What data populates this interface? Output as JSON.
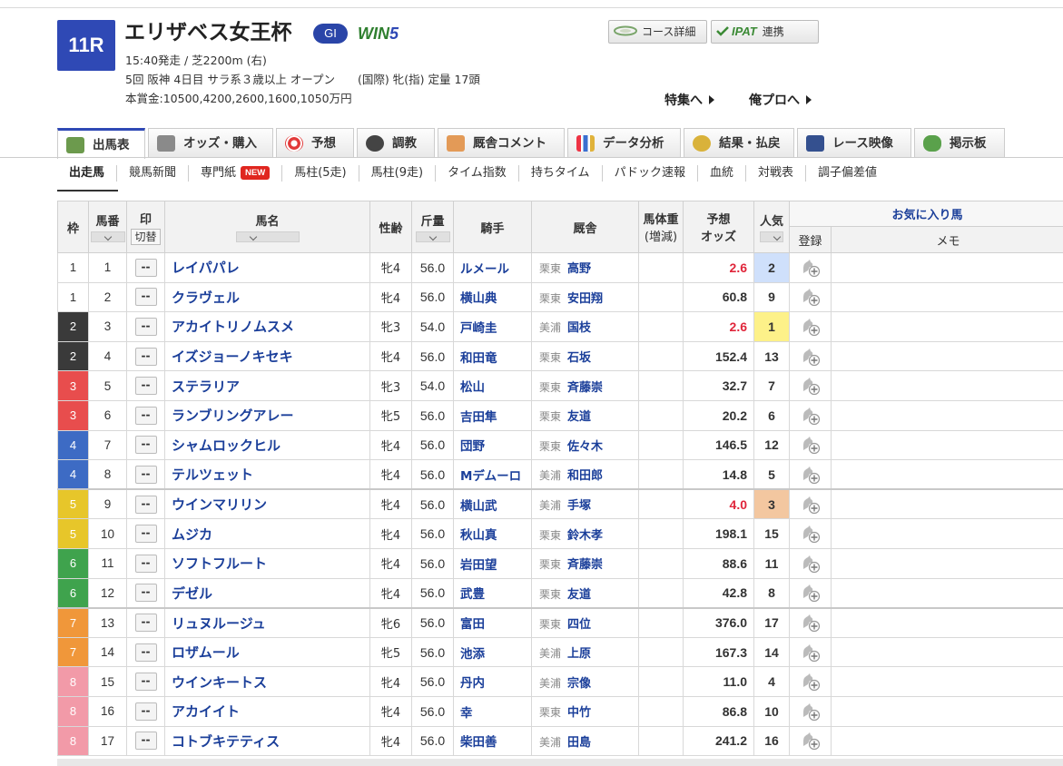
{
  "race": {
    "number": "11R",
    "title": "エリザベス女王杯",
    "grade": "GI",
    "win5_a": "WIN",
    "win5_b": "5",
    "line1": "15:40発走 / 芝2200m (右)",
    "line2": "5回 阪神 4日目 サラ系３歳以上 オープン　　(国際) 牝(指) 定量 17頭",
    "line3": "本賞金:10500,4200,2600,1600,1050万円"
  },
  "header_buttons": {
    "course_detail": "コース詳細",
    "ipat": "IPAT",
    "ipat_suffix": "連携",
    "special": "特集へ",
    "orepro": "俺プロへ"
  },
  "tabs": [
    "出馬表",
    "オッズ・購入",
    "予想",
    "調教",
    "厩舎コメント",
    "データ分析",
    "結果・払戻",
    "レース映像",
    "掲示板"
  ],
  "subtabs": [
    "出走馬",
    "競馬新聞",
    "専門紙",
    "馬柱(5走)",
    "馬柱(9走)",
    "タイム指数",
    "持ちタイム",
    "パドック速報",
    "血統",
    "対戦表",
    "調子偏差値"
  ],
  "subtab_new": "NEW",
  "columns": {
    "waku": "枠",
    "umaban": "馬番",
    "mark": "印",
    "switch": "切替",
    "name": "馬名",
    "sex_age": "性齢",
    "kinryo": "斤量",
    "jockey": "騎手",
    "trainer": "厩舎",
    "weight_a": "馬体重",
    "weight_b": "(増減)",
    "odds_a": "予想",
    "odds_b": "オッズ",
    "ninki": "人気",
    "favorite": "お気に入り馬",
    "register": "登録",
    "memo": "メモ"
  },
  "mark_placeholder": "--",
  "waku_colors": {
    "1": {
      "bg": "#ffffff",
      "fg": "#333333"
    },
    "2": {
      "bg": "#3a3a3a",
      "fg": "#ffffff"
    },
    "3": {
      "bg": "#e84d4d",
      "fg": "#ffffff"
    },
    "4": {
      "bg": "#3d6bc4",
      "fg": "#ffffff"
    },
    "5": {
      "bg": "#e7c62a",
      "fg": "#ffffff"
    },
    "6": {
      "bg": "#3fa34d",
      "fg": "#ffffff"
    },
    "7": {
      "bg": "#f0973a",
      "fg": "#ffffff"
    },
    "8": {
      "bg": "#f29aa8",
      "fg": "#ffffff"
    }
  },
  "ninki_highlight": {
    "1": "#fdf189",
    "2": "#cfe0fb",
    "3": "#f3c7a0"
  },
  "horses": [
    {
      "waku": "1",
      "umaban": "1",
      "name": "レイパパレ",
      "sex_age": "牝4",
      "kinryo": "56.0",
      "jockey": "ルメール",
      "area": "栗東",
      "trainer": "高野",
      "odds": "2.6",
      "ninki": "2",
      "hot": true
    },
    {
      "waku": "1",
      "umaban": "2",
      "name": "クラヴェル",
      "sex_age": "牝4",
      "kinryo": "56.0",
      "jockey": "横山典",
      "area": "栗東",
      "trainer": "安田翔",
      "odds": "60.8",
      "ninki": "9",
      "hot": false
    },
    {
      "waku": "2",
      "umaban": "3",
      "name": "アカイトリノムスメ",
      "sex_age": "牝3",
      "kinryo": "54.0",
      "jockey": "戸崎圭",
      "area": "美浦",
      "trainer": "国枝",
      "odds": "2.6",
      "ninki": "1",
      "hot": true
    },
    {
      "waku": "2",
      "umaban": "4",
      "name": "イズジョーノキセキ",
      "sex_age": "牝4",
      "kinryo": "56.0",
      "jockey": "和田竜",
      "area": "栗東",
      "trainer": "石坂",
      "odds": "152.4",
      "ninki": "13",
      "hot": false
    },
    {
      "waku": "3",
      "umaban": "5",
      "name": "ステラリア",
      "sex_age": "牝3",
      "kinryo": "54.0",
      "jockey": "松山",
      "area": "栗東",
      "trainer": "斉藤崇",
      "odds": "32.7",
      "ninki": "7",
      "hot": false
    },
    {
      "waku": "3",
      "umaban": "6",
      "name": "ランブリングアレー",
      "sex_age": "牝5",
      "kinryo": "56.0",
      "jockey": "吉田隼",
      "area": "栗東",
      "trainer": "友道",
      "odds": "20.2",
      "ninki": "6",
      "hot": false
    },
    {
      "waku": "4",
      "umaban": "7",
      "name": "シャムロックヒル",
      "sex_age": "牝4",
      "kinryo": "56.0",
      "jockey": "団野",
      "area": "栗東",
      "trainer": "佐々木",
      "odds": "146.5",
      "ninki": "12",
      "hot": false
    },
    {
      "waku": "4",
      "umaban": "8",
      "name": "テルツェット",
      "sex_age": "牝4",
      "kinryo": "56.0",
      "jockey": "Mデムーロ",
      "area": "美浦",
      "trainer": "和田郎",
      "odds": "14.8",
      "ninki": "5",
      "hot": false
    },
    {
      "waku": "5",
      "umaban": "9",
      "name": "ウインマリリン",
      "sex_age": "牝4",
      "kinryo": "56.0",
      "jockey": "横山武",
      "area": "美浦",
      "trainer": "手塚",
      "odds": "4.0",
      "ninki": "3",
      "hot": true
    },
    {
      "waku": "5",
      "umaban": "10",
      "name": "ムジカ",
      "sex_age": "牝4",
      "kinryo": "56.0",
      "jockey": "秋山真",
      "area": "栗東",
      "trainer": "鈴木孝",
      "odds": "198.1",
      "ninki": "15",
      "hot": false
    },
    {
      "waku": "6",
      "umaban": "11",
      "name": "ソフトフルート",
      "sex_age": "牝4",
      "kinryo": "56.0",
      "jockey": "岩田望",
      "area": "栗東",
      "trainer": "斉藤崇",
      "odds": "88.6",
      "ninki": "11",
      "hot": false
    },
    {
      "waku": "6",
      "umaban": "12",
      "name": "デゼル",
      "sex_age": "牝4",
      "kinryo": "56.0",
      "jockey": "武豊",
      "area": "栗東",
      "trainer": "友道",
      "odds": "42.8",
      "ninki": "8",
      "hot": false
    },
    {
      "waku": "7",
      "umaban": "13",
      "name": "リュヌルージュ",
      "sex_age": "牝6",
      "kinryo": "56.0",
      "jockey": "富田",
      "area": "栗東",
      "trainer": "四位",
      "odds": "376.0",
      "ninki": "17",
      "hot": false
    },
    {
      "waku": "7",
      "umaban": "14",
      "name": "ロザムール",
      "sex_age": "牝5",
      "kinryo": "56.0",
      "jockey": "池添",
      "area": "美浦",
      "trainer": "上原",
      "odds": "167.3",
      "ninki": "14",
      "hot": false
    },
    {
      "waku": "8",
      "umaban": "15",
      "name": "ウインキートス",
      "sex_age": "牝4",
      "kinryo": "56.0",
      "jockey": "丹内",
      "area": "美浦",
      "trainer": "宗像",
      "odds": "11.0",
      "ninki": "4",
      "hot": false
    },
    {
      "waku": "8",
      "umaban": "16",
      "name": "アカイイト",
      "sex_age": "牝4",
      "kinryo": "56.0",
      "jockey": "幸",
      "area": "栗東",
      "trainer": "中竹",
      "odds": "86.8",
      "ninki": "10",
      "hot": false
    },
    {
      "waku": "8",
      "umaban": "17",
      "name": "コトブキテティス",
      "sex_age": "牝4",
      "kinryo": "56.0",
      "jockey": "柴田善",
      "area": "美浦",
      "trainer": "田島",
      "odds": "241.2",
      "ninki": "16",
      "hot": false
    }
  ]
}
